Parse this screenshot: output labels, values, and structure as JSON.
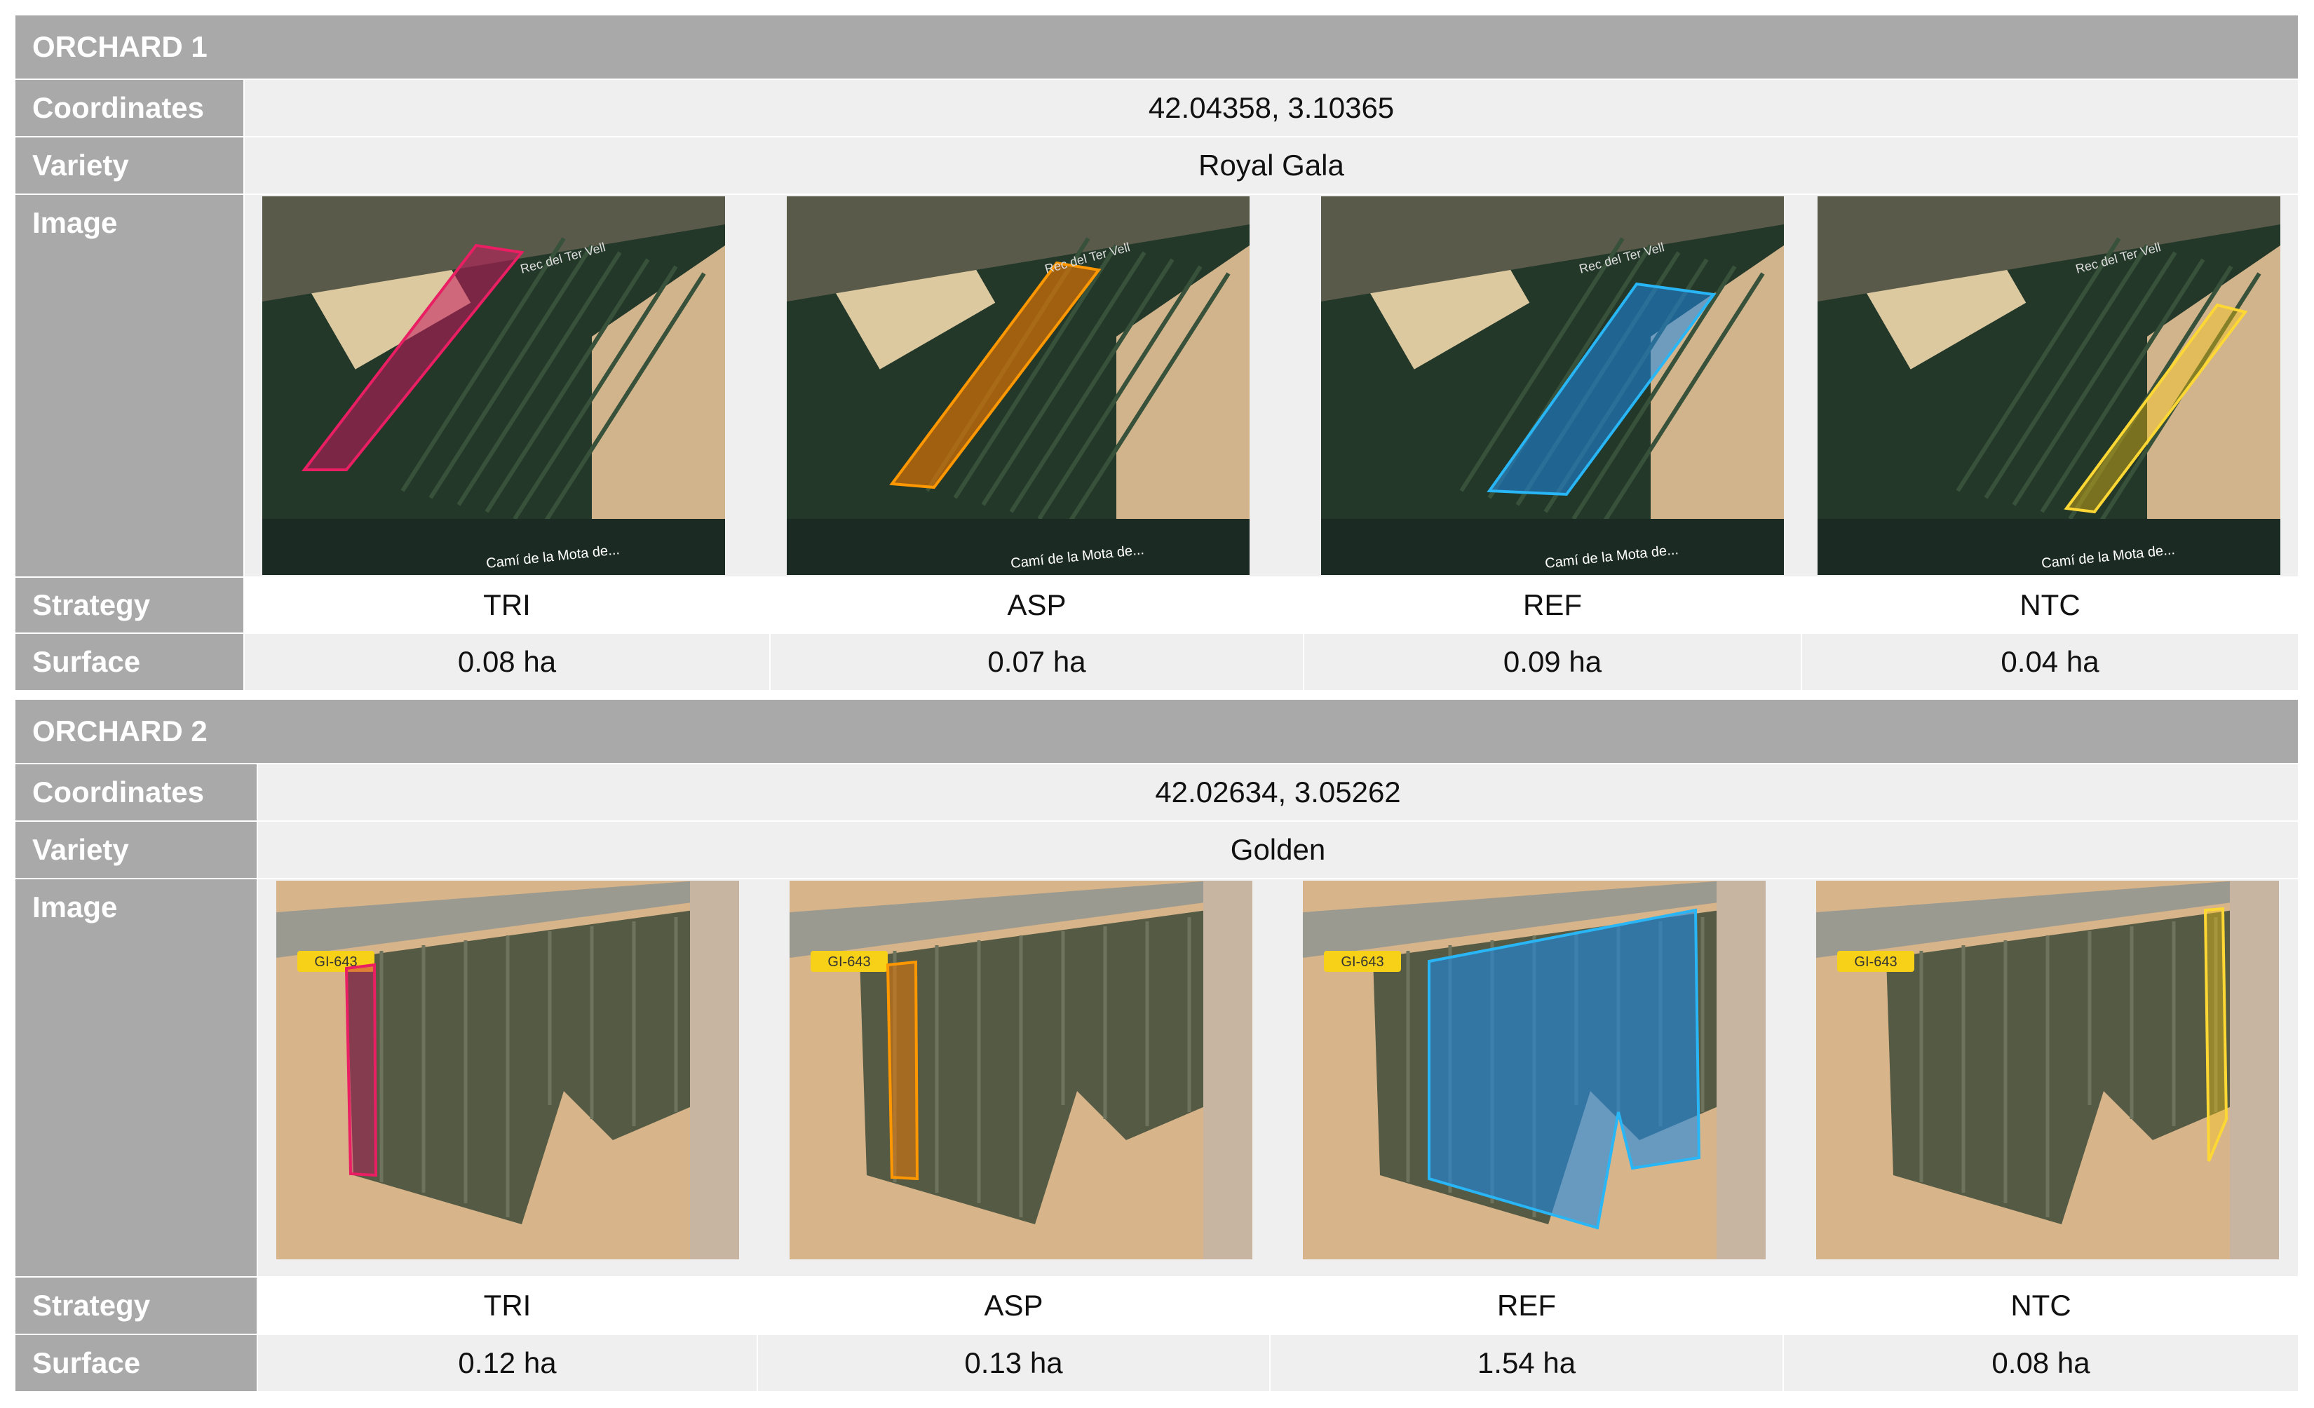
{
  "orchards": [
    {
      "title": "ORCHARD 1",
      "coordinates_label": "Coordinates",
      "coordinates": "42.04358, 3.10365",
      "variety_label": "Variety",
      "variety": "Royal Gala",
      "image_label": "Image",
      "strategy_label": "Strategy",
      "surface_label": "Surface",
      "map_labels": {
        "road_top": "Rec del Ter Vell",
        "road_bottom": "Camí de la Mota de..."
      },
      "plots": [
        {
          "strategy": "TRI",
          "surface": "0.08 ha",
          "color": "#c2185b"
        },
        {
          "strategy": "ASP",
          "surface": "0.07 ha",
          "color": "#f57c00"
        },
        {
          "strategy": "REF",
          "surface": "0.09 ha",
          "color": "#1e88e5"
        },
        {
          "strategy": "NTC",
          "surface": "0.04 ha",
          "color": "#f9c80e"
        }
      ]
    },
    {
      "title": "ORCHARD 2",
      "coordinates_label": "Coordinates",
      "coordinates": "42.02634, 3.05262",
      "variety_label": "Variety",
      "variety": "Golden",
      "image_label": "Image",
      "strategy_label": "Strategy",
      "surface_label": "Surface",
      "map_labels": {
        "road_sign": "GI-643"
      },
      "plots": [
        {
          "strategy": "TRI",
          "surface": "0.12 ha",
          "color": "#c2185b"
        },
        {
          "strategy": "ASP",
          "surface": "0.13 ha",
          "color": "#f57c00"
        },
        {
          "strategy": "REF",
          "surface": "1.54 ha",
          "color": "#1e88e5"
        },
        {
          "strategy": "NTC",
          "surface": "0.08 ha",
          "color": "#f9c80e"
        }
      ]
    }
  ]
}
